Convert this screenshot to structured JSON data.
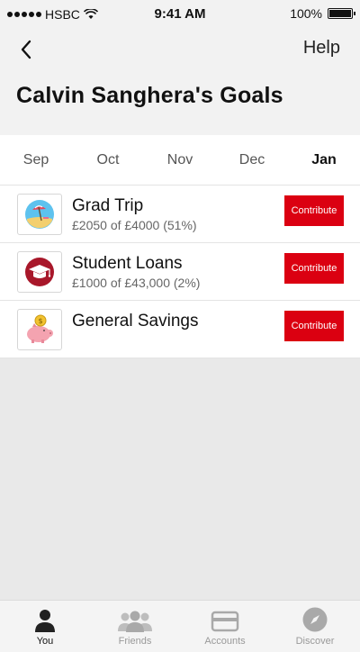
{
  "status_bar": {
    "carrier": "HSBC",
    "time": "9:41 AM",
    "battery": "100%"
  },
  "header": {
    "help_label": "Help",
    "title": "Calvin Sanghera's Goals"
  },
  "months": [
    {
      "label": "Sep",
      "active": false
    },
    {
      "label": "Oct",
      "active": false
    },
    {
      "label": "Nov",
      "active": false
    },
    {
      "label": "Dec",
      "active": false
    },
    {
      "label": "Jan",
      "active": true
    }
  ],
  "goals": [
    {
      "name": "Grad Trip",
      "progress": "£2050 of £4000 (51%)",
      "icon": "beach-icon",
      "button": "Contribute"
    },
    {
      "name": "Student Loans",
      "progress": "£1000 of £43,000 (2%)",
      "icon": "graduation-cap-icon",
      "button": "Contribute"
    },
    {
      "name": "General Savings",
      "progress": "",
      "icon": "piggy-bank-icon",
      "button": "Contribute"
    }
  ],
  "tabs": [
    {
      "label": "You",
      "icon": "person-icon",
      "active": true
    },
    {
      "label": "Friends",
      "icon": "friends-icon",
      "active": false
    },
    {
      "label": "Accounts",
      "icon": "card-icon",
      "active": false
    },
    {
      "label": "Discover",
      "icon": "compass-icon",
      "active": false
    }
  ],
  "colors": {
    "brand_red": "#db0011",
    "header_bg": "#f2f2f2",
    "body_bg": "#e9e9e9"
  }
}
